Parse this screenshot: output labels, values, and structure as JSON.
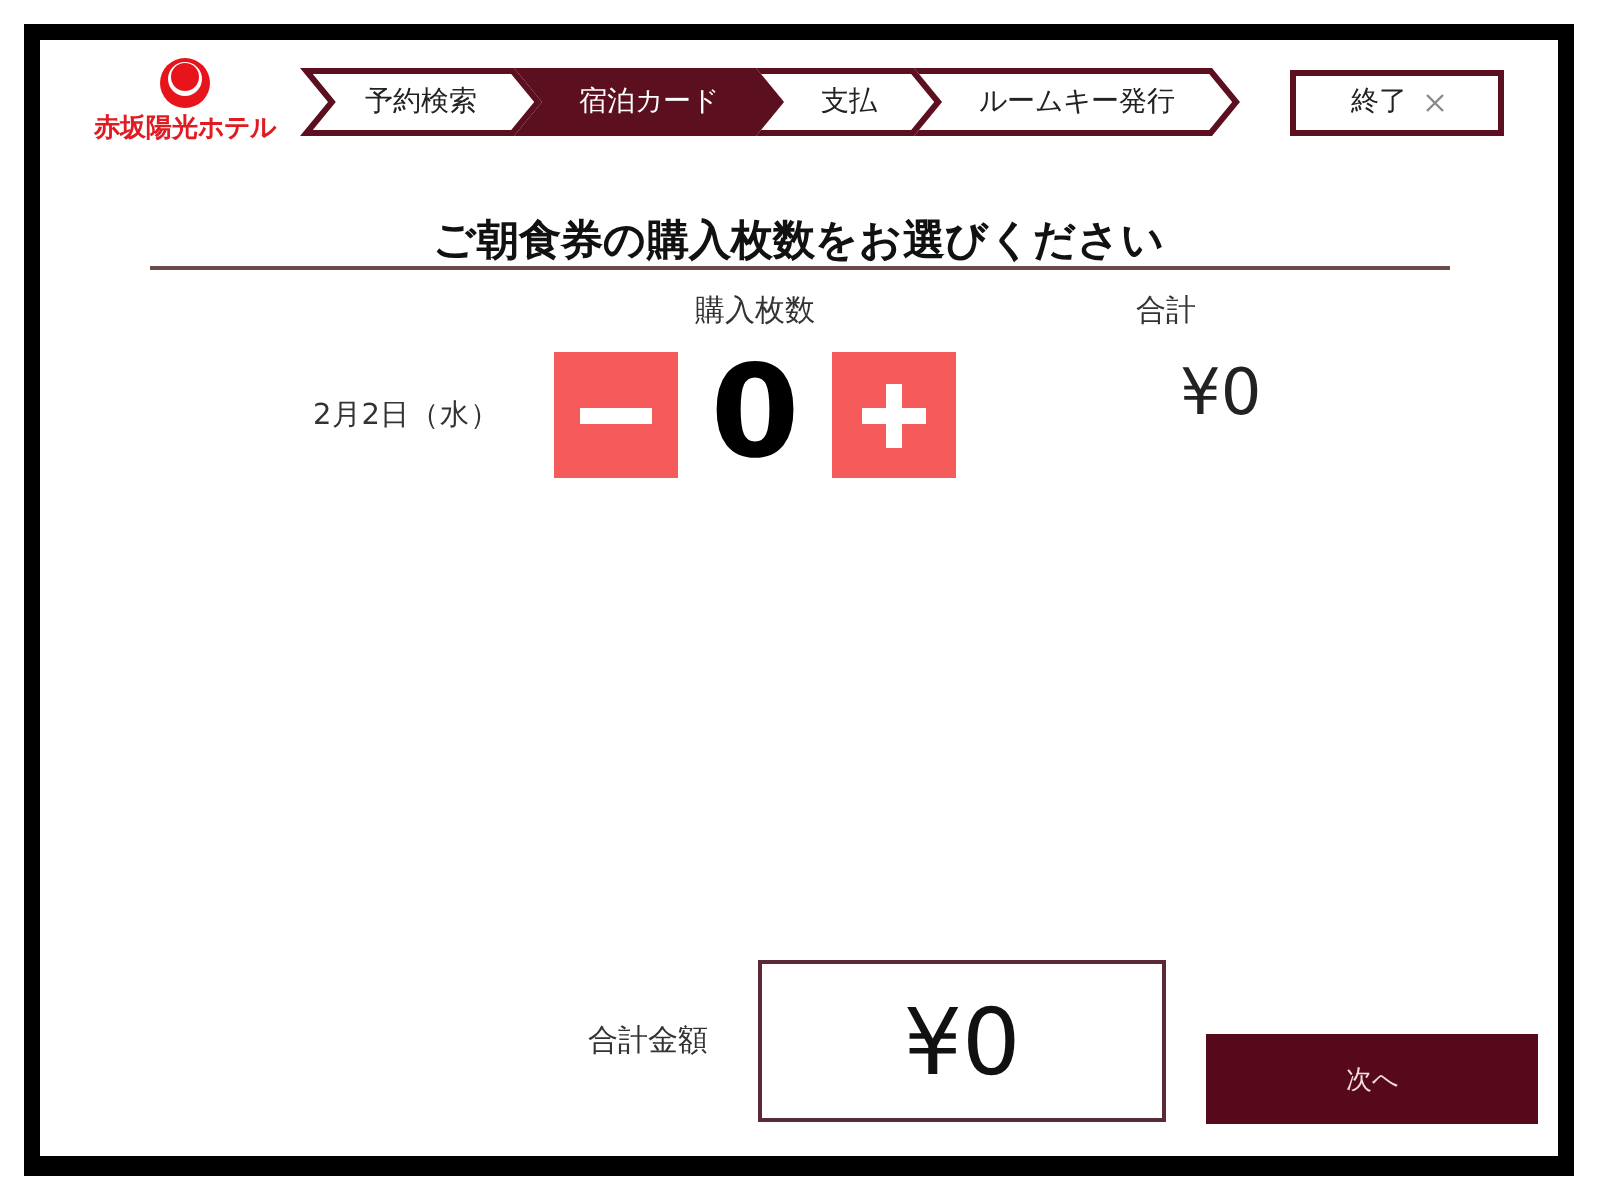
{
  "logo": {
    "name": "赤坂陽光ホテル"
  },
  "steps": [
    {
      "label": "予約検索",
      "current": false
    },
    {
      "label": "宿泊カード",
      "current": true
    },
    {
      "label": "支払",
      "current": false
    },
    {
      "label": "ルームキー発行",
      "current": false
    }
  ],
  "exit_button": {
    "label": "終了"
  },
  "heading": "ご朝食券の購入枚数をお選びください",
  "columns": [
    "購入枚数",
    "合計"
  ],
  "rows": [
    {
      "date": "2月2日（水）",
      "quantity": "0",
      "subtotal": "¥0"
    }
  ],
  "summary": {
    "label": "合計金額",
    "total": "¥0"
  },
  "next_button": {
    "label": "次へ"
  }
}
